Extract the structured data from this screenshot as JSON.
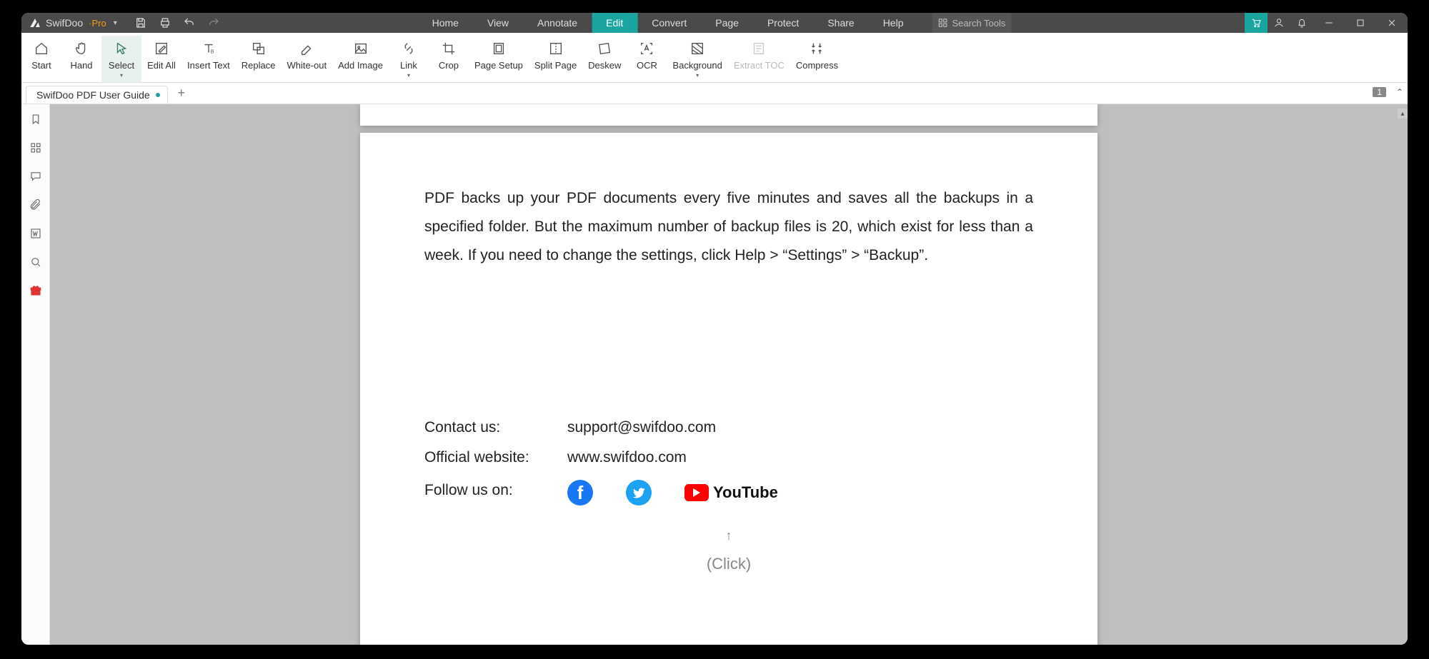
{
  "app": {
    "name": "SwifDoo",
    "edition": "·Pro"
  },
  "menu": {
    "items": [
      "Home",
      "View",
      "Annotate",
      "Edit",
      "Convert",
      "Page",
      "Protect",
      "Share",
      "Help"
    ],
    "active": "Edit"
  },
  "search": {
    "placeholder": "Search Tools"
  },
  "ribbon": [
    {
      "id": "start",
      "label": "Start"
    },
    {
      "id": "hand",
      "label": "Hand"
    },
    {
      "id": "select",
      "label": "Select",
      "selected": true,
      "dropdown": true
    },
    {
      "id": "editall",
      "label": "Edit All"
    },
    {
      "id": "inserttext",
      "label": "Insert Text"
    },
    {
      "id": "replace",
      "label": "Replace"
    },
    {
      "id": "whiteout",
      "label": "White-out"
    },
    {
      "id": "addimage",
      "label": "Add Image"
    },
    {
      "id": "link",
      "label": "Link",
      "dropdown": true
    },
    {
      "id": "crop",
      "label": "Crop"
    },
    {
      "id": "pagesetup",
      "label": "Page Setup"
    },
    {
      "id": "splitpage",
      "label": "Split Page"
    },
    {
      "id": "deskew",
      "label": "Deskew"
    },
    {
      "id": "ocr",
      "label": "OCR"
    },
    {
      "id": "background",
      "label": "Background",
      "dropdown": true
    },
    {
      "id": "extracttoc",
      "label": "Extract TOC",
      "disabled": true
    },
    {
      "id": "compress",
      "label": "Compress"
    }
  ],
  "tab": {
    "title": "SwifDoo PDF User Guide",
    "modified": true
  },
  "pagecounter": "1",
  "document": {
    "paragraph": "PDF backs up your PDF documents every five minutes and saves all the backups in a specified folder. But the maximum number of backup files is 20, which exist for less than a week. If you need to change the settings, click Help > “Settings” > “Backup”.",
    "contact_label": "Contact us:",
    "contact_value": "support@swifdoo.com",
    "website_label": "Official website:",
    "website_value": "www.swifdoo.com",
    "follow_label": "Follow us on:",
    "youtube_label": "YouTube",
    "hint_arrow": "↑",
    "hint_text": "(Click)"
  },
  "sidepanel": [
    {
      "id": "bookmarks",
      "name": "bookmark-icon"
    },
    {
      "id": "thumbnails",
      "name": "grid-icon"
    },
    {
      "id": "comments",
      "name": "comment-icon"
    },
    {
      "id": "attachments",
      "name": "paperclip-icon"
    },
    {
      "id": "word",
      "name": "word-icon"
    },
    {
      "id": "searchpanel",
      "name": "search-icon"
    },
    {
      "id": "gift",
      "name": "gift-icon"
    }
  ]
}
